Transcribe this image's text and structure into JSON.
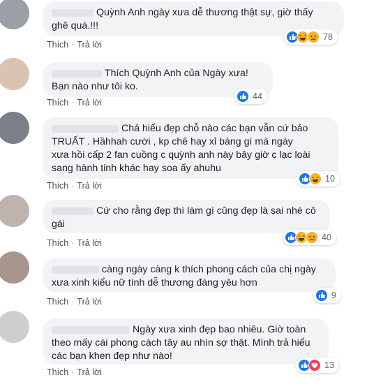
{
  "actions": {
    "like": "Thích",
    "reply": "Trả lời",
    "separator": "·"
  },
  "comments": [
    {
      "text": "Quỳnh Anh ngày xưa dễ thương thật sự, giờ thấy\nghê quá.!!!",
      "reactions": [
        "like-icon",
        "haha-icon",
        "sad-icon"
      ],
      "count": "78"
    },
    {
      "text": "Thích Quỳnh Anh của Ngày xưa!\nBạn nào như tôi ko.",
      "reactions": [
        "like-icon"
      ],
      "count": "44"
    },
    {
      "text": "Chả hiểu đẹp chỗ nào các bạn vẫn cứ bảo\nTRUẤT . Hầhhah cười , kp chê hay xỉ báng gì mà ngày\nxưa hồi cấp 2 fan cuồng c quỳnh anh này bây giờ c lạc loài\nsang hành tinh khác hay soa ấy ahuhu",
      "reactions": [
        "like-icon",
        "haha-icon"
      ],
      "count": "10"
    },
    {
      "text": "Cứ cho rằng đẹp thì làm gì cũng đẹp là sai nhé cô\ngái",
      "reactions": [
        "like-icon",
        "haha-icon",
        "sad-icon"
      ],
      "count": "40"
    },
    {
      "text": "càng ngày càng k thích phong cách của chị ngày\nxưa xinh kiểu nữ tính dễ thương đáng yêu hơn",
      "reactions": [
        "like-icon"
      ],
      "count": "9"
    },
    {
      "text": "Ngày xưa xinh đẹp bao nhiêu. Giờ toàn\ntheo mấy cái phong cách tây au nhìn sợ thật. Mình trả hiểu\ncác bạn khen đẹp như nào!",
      "reactions": [
        "like-icon",
        "love-icon"
      ],
      "count": "13"
    }
  ],
  "colors": {
    "like": "#1877f2",
    "love": "#f33e58",
    "haha": "#f7b125",
    "bubble": "#f2f3f5"
  }
}
